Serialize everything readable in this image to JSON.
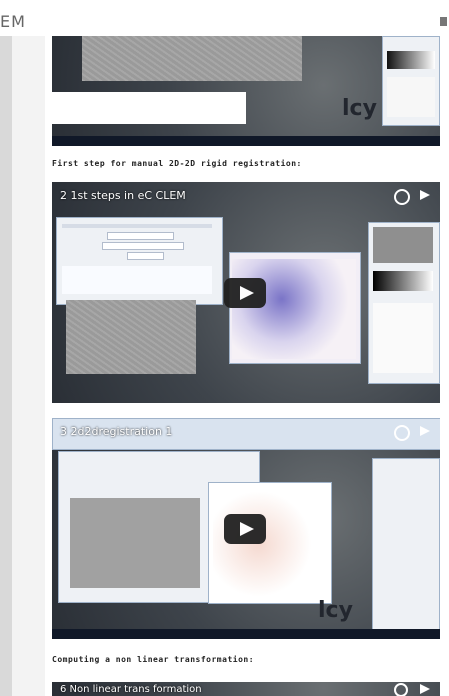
{
  "site": {
    "title": "EM"
  },
  "captions": {
    "first_step": "First step for manual 2D-2D rigid registration:",
    "nonlinear": "Computing a non linear transformation:"
  },
  "videos": [
    {
      "title": "2 1st steps in eC CLEM"
    },
    {
      "title": "3 2d2dregistration 1"
    },
    {
      "title": "6 Non linear trans formation"
    }
  ],
  "branding": {
    "icy_logo": "lcy"
  },
  "colors": {
    "accent_red": "#e4002b",
    "dark": "#212121"
  },
  "icons": [
    "menu-icon",
    "play-icon",
    "clock-icon",
    "share-icon"
  ]
}
